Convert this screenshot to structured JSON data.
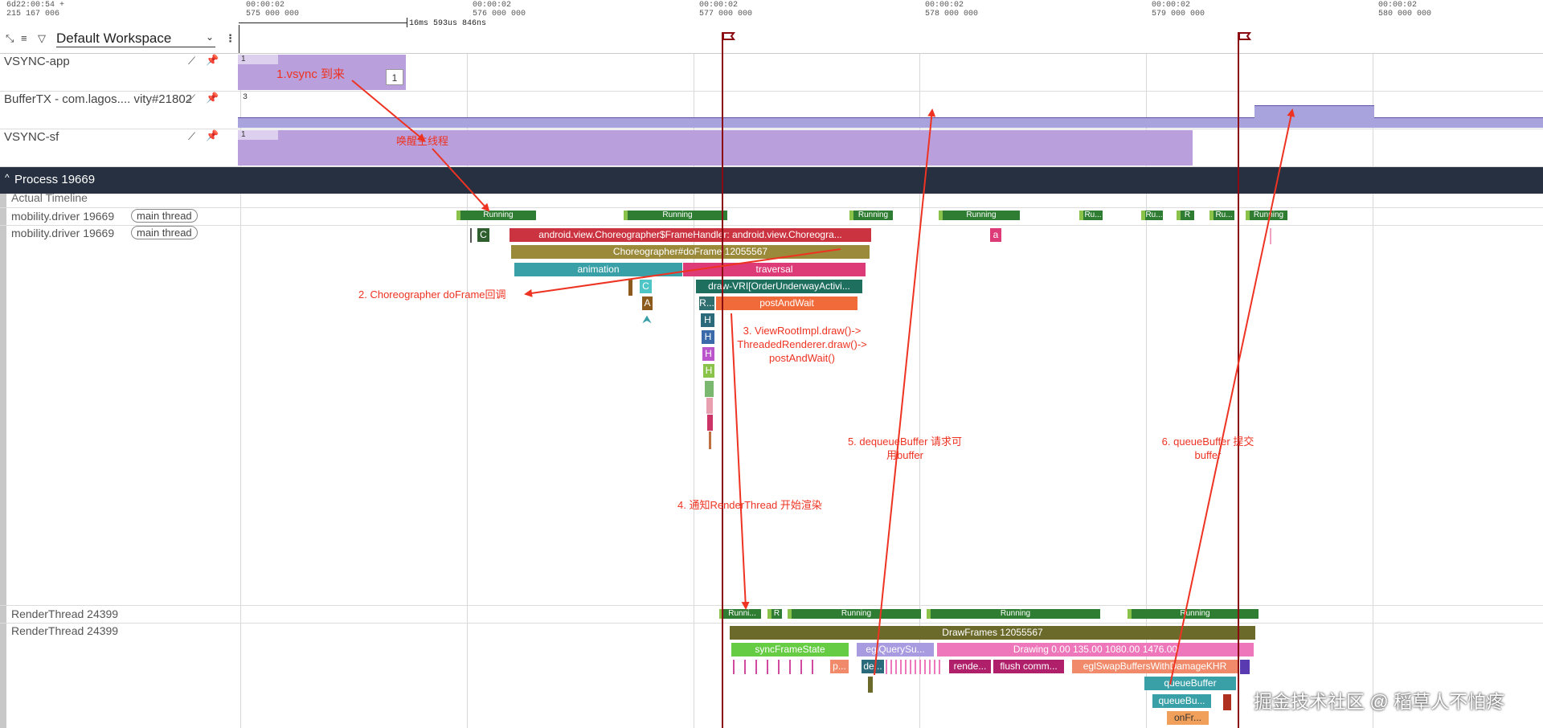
{
  "header": {
    "corner_time": "6d22:00:54 +",
    "corner_ns": "215 167 006",
    "ticks": [
      {
        "time": "00:00:02",
        "ns": "575 000 000"
      },
      {
        "time": "00:00:02",
        "ns": "576 000 000"
      },
      {
        "time": "00:00:02",
        "ns": "577 000 000"
      },
      {
        "time": "00:00:02",
        "ns": "578 000 000"
      },
      {
        "time": "00:00:02",
        "ns": "579 000 000"
      },
      {
        "time": "00:00:02",
        "ns": "580 000 000"
      }
    ],
    "span_label": "16ms 593us 846ns",
    "workspace": "Default Workspace"
  },
  "tracks": {
    "vsync_app": "VSYNC-app",
    "vsync_app_value": "1",
    "vsync_app_box": "1",
    "buffer_tx": "BufferTX - com.lagos.... vity#21802",
    "buffer_tx_value": "3",
    "vsync_sf": "VSYNC-sf",
    "vsync_sf_value": "1",
    "process": "Process 19669",
    "actual_timeline": "Actual Timeline",
    "main1": "mobility.driver 19669",
    "main2": "mobility.driver 19669",
    "main_pill": "main thread",
    "rt1": "RenderThread 24399",
    "rt2": "RenderThread 24399"
  },
  "running": {
    "running": "Running",
    "ru": "Ru...",
    "r": "R",
    "runni": "Runni..."
  },
  "slices": {
    "c1": "C",
    "handler": "android.view.Choreographer$FrameHandler: android.view.Choreogra...",
    "doframe": "Choreographer#doFrame 12055567",
    "animation": "animation",
    "traversal": "traversal",
    "c2": "C",
    "a1": "A",
    "draw": "draw-VRI[OrderUnderwayActivi...",
    "r1": "R...",
    "post": "postAndWait",
    "h": "H",
    "a2": "a",
    "drawframes": "DrawFrames 12055567",
    "syncframe": "syncFrameState",
    "egl_query": "eglQuerySu...",
    "drawing": "Drawing  0.00 135.00 1080.00 1476.00",
    "p": "p...",
    "de": "de...",
    "rende": "rende...",
    "flush": "flush comm...",
    "swap": "eglSwapBuffersWithDamageKHR",
    "queuebuffer": "queueBuffer",
    "queuebu": "queueBu...",
    "onfr": "onFr..."
  },
  "annotations": {
    "a1": "1.vsync 到来",
    "wake": "唤醒主线程",
    "a2": "2. Choreographer doFrame回调",
    "a3_l1": "3. ViewRootImpl.draw()->",
    "a3_l2": "ThreadedRenderer.draw()->",
    "a3_l3": "postAndWait()",
    "a4": "4. 通知RenderThread 开始渲染",
    "a5_l1": "5. dequeueBuffer 请求可",
    "a5_l2": "用buffer",
    "a6_l1": "6. queueBuffer 提交",
    "a6_l2": "buffer"
  },
  "watermark": "掘金技术社区 @ 稻草人不怕疼",
  "colors": {
    "annotation": "#ee3322",
    "flag_line": "#8b0a12",
    "process_bar": "#263040",
    "vsync": "#b9a0dc",
    "running": "#2e7d32"
  }
}
